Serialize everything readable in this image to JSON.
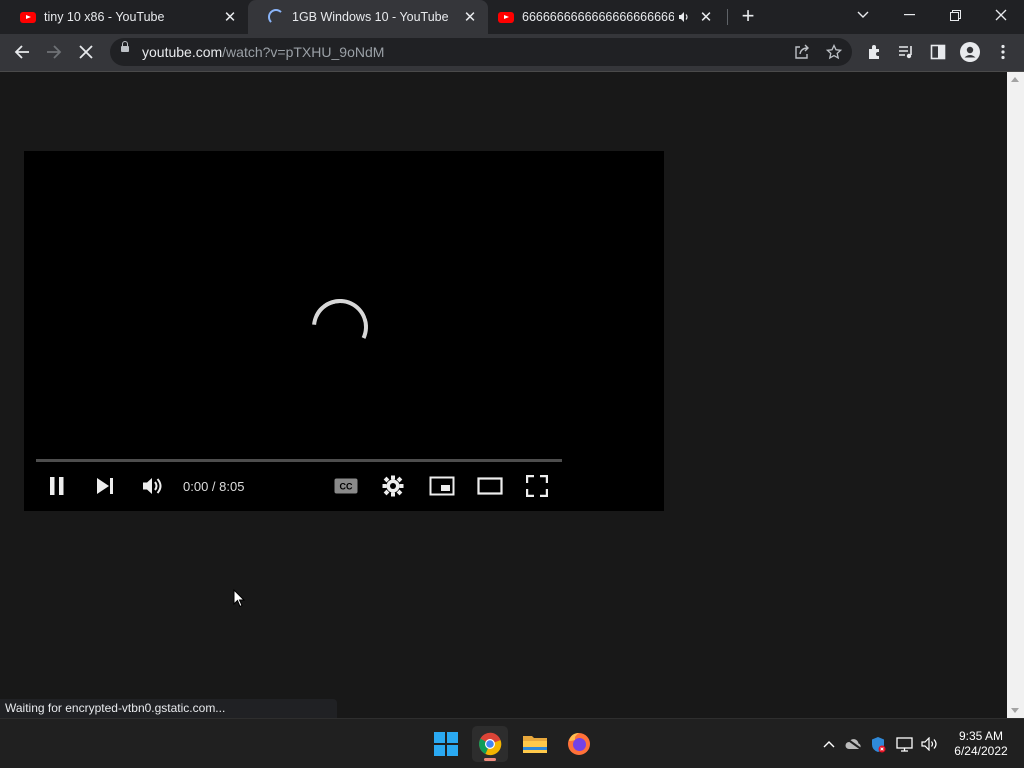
{
  "tabs": [
    {
      "title": "tiny 10 x86 - YouTube",
      "icon": "youtube-icon",
      "state": "inactive"
    },
    {
      "title": "1GB Windows 10 - YouTube",
      "icon": "loading-spinner-icon",
      "state": "active"
    },
    {
      "title": "6666666666666666666666666",
      "icon": "youtube-icon",
      "state": "inactive",
      "audio": "speaker-icon"
    }
  ],
  "window_controls": {
    "dropdown": "tab-search-icon",
    "minimize": "minimize-icon",
    "restore": "restore-icon",
    "close": "close-icon"
  },
  "toolbar": {
    "url_host": "youtube.com",
    "url_path": "/watch?v=pTXHU_9oNdM",
    "icons": [
      "back-icon",
      "forward-icon",
      "stop-icon",
      "lock-icon",
      "share-icon",
      "bookmark-star-icon",
      "extensions-icon",
      "media-control-icon",
      "side-panel-icon",
      "profile-icon",
      "menu-icon"
    ]
  },
  "player": {
    "time_display": "0:00 / 8:05",
    "progress_fraction": 0,
    "controls": [
      "pause-icon",
      "next-icon",
      "volume-icon",
      "captions-icon",
      "settings-gear-icon",
      "miniplayer-icon",
      "theater-mode-icon",
      "fullscreen-icon"
    ],
    "accent": "#ff0000"
  },
  "status_bar": {
    "text": "Waiting for encrypted-vtbn0.gstatic.com..."
  },
  "taskbar": {
    "apps": [
      "windows-start-icon",
      "chrome-icon",
      "file-explorer-icon",
      "firefox-icon"
    ],
    "tray": [
      "show-hidden-icons-chevron",
      "onedrive-offline-icon",
      "windows-security-icon",
      "network-icon",
      "volume-icon"
    ],
    "clock_time": "9:35 AM",
    "clock_date": "6/24/2022"
  }
}
